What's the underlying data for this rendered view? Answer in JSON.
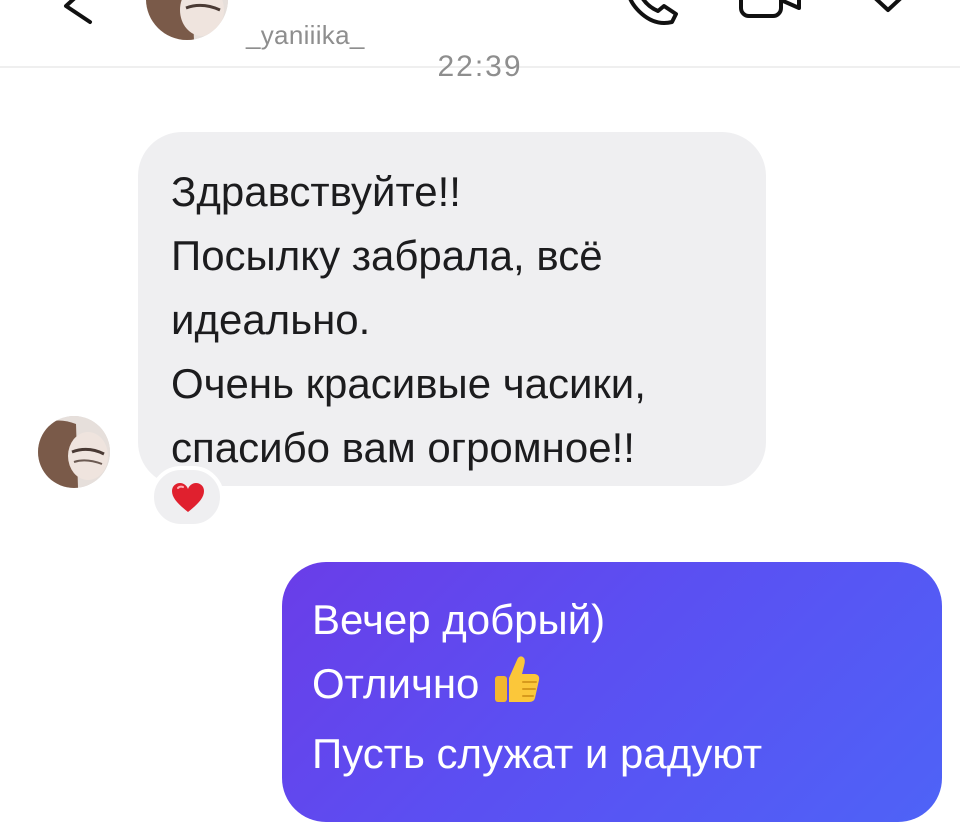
{
  "header": {
    "username": "_yaniiika_",
    "icons": {
      "back": "chevron-left-icon",
      "call": "phone-icon",
      "video": "video-camera-icon",
      "info": "tag-icon"
    }
  },
  "conversation": {
    "timestamp": "22:39",
    "incoming": {
      "lines": [
        "Здравствуйте!!",
        "Посылку забрала, всё",
        "идеально.",
        "Очень красивые часики,",
        "спасибо вам огромное!!"
      ],
      "reaction": "❤️"
    },
    "outgoing": {
      "lines": [
        "Вечер добрый)",
        "Отлично",
        "Пусть служат и радуют"
      ],
      "emoji_icon": "thumbs-up-icon"
    }
  },
  "colors": {
    "incoming_bubble": "#efeff1",
    "outgoing_bubble_start": "#6a3de8",
    "outgoing_bubble_end": "#4e63f7",
    "secondary_text": "#8e8e8e"
  }
}
